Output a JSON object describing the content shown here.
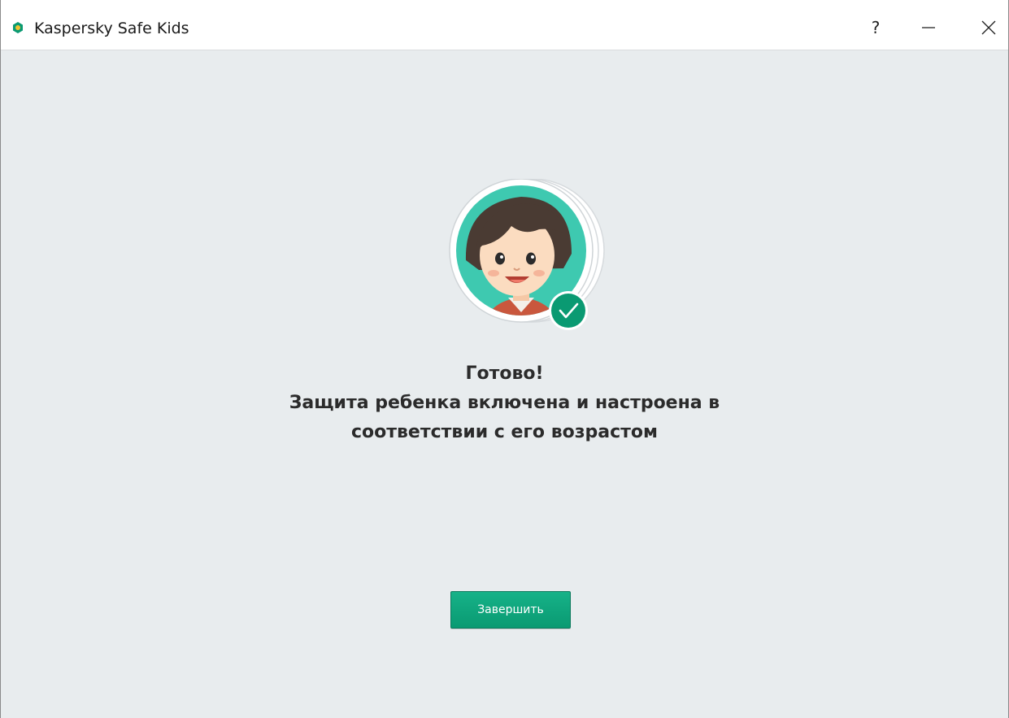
{
  "window": {
    "title": "Kaspersky Safe Kids",
    "help_label": "?",
    "minimize_icon": "minimize-icon",
    "close_icon": "close-icon"
  },
  "main": {
    "heading_line1": "Готово!",
    "heading_line2": "Защита ребенка включена и настроена в",
    "heading_line3": "соответствии с его возрастом",
    "finish_button_label": "Завершить",
    "avatar_icon": "child-avatar-icon",
    "status_icon": "checkmark-icon"
  },
  "colors": {
    "accent": "#0a9a72",
    "background": "#e8ecee",
    "avatar_circle": "#3ec9b0"
  }
}
